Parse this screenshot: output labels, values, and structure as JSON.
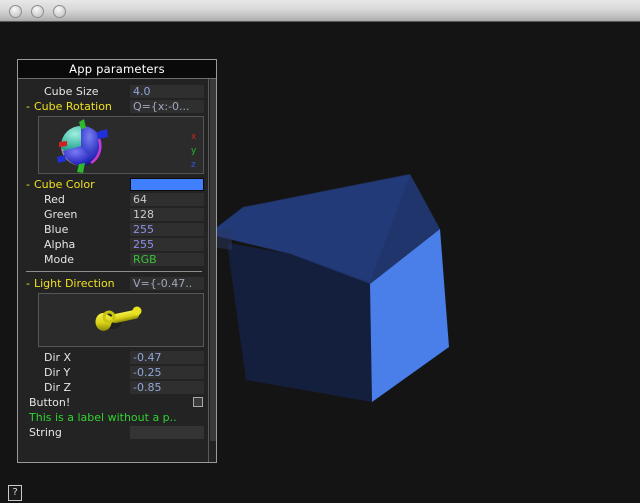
{
  "window": {
    "title": "",
    "buttons": [
      "close",
      "minimize",
      "zoom"
    ],
    "background_color": "#141414"
  },
  "help_button": {
    "glyph": "?"
  },
  "tweakbar": {
    "title": "App parameters",
    "rows": [
      {
        "type": "value",
        "label": "Cube Size",
        "value": "4.0",
        "value_color": "#8fa6d8"
      },
      {
        "type": "group",
        "label": "Cube Rotation",
        "value": "Q={x:-0...",
        "expander": "-",
        "value_color": "#9fa9bd"
      },
      {
        "type": "widget",
        "name": "rotation-ball",
        "axes": [
          "x",
          "y",
          "z"
        ],
        "axis_colors": [
          "#cc2222",
          "#22bb22",
          "#3355dd"
        ]
      },
      {
        "type": "color",
        "label": "Cube Color",
        "expander": "-",
        "swatch_color": "#4080ff"
      },
      {
        "type": "value",
        "label": "Red",
        "value": "64",
        "value_color": "#c9c9c9"
      },
      {
        "type": "value",
        "label": "Green",
        "value": "128",
        "value_color": "#c9c9c9"
      },
      {
        "type": "value",
        "label": "Blue",
        "value": "255",
        "value_color": "#8f8fe8"
      },
      {
        "type": "value",
        "label": "Alpha",
        "value": "255",
        "value_color": "#8f8fe8"
      },
      {
        "type": "value",
        "label": "Mode",
        "value": "RGB",
        "value_color": "#35c535"
      },
      {
        "type": "separator"
      },
      {
        "type": "group",
        "label": "Light Direction",
        "value": "V={-0.47..",
        "expander": "-",
        "value_color": "#9fa9bd"
      },
      {
        "type": "widget",
        "name": "light-arrow"
      },
      {
        "type": "value",
        "label": "Dir X",
        "value": "-0.47",
        "value_color": "#8fa6d8"
      },
      {
        "type": "value",
        "label": "Dir Y",
        "value": "-0.25",
        "value_color": "#8fa6d8"
      },
      {
        "type": "value",
        "label": "Dir Z",
        "value": "-0.85",
        "value_color": "#8fa6d8"
      },
      {
        "type": "button",
        "label": "Button!"
      },
      {
        "type": "note",
        "label": "This is a label without a p.."
      },
      {
        "type": "text",
        "label": "String",
        "value": ""
      }
    ]
  },
  "scene": {
    "object": "cube",
    "face_colors": {
      "front_right": "#4a7ee8",
      "top": "#20356b",
      "left": "#15203f"
    }
  }
}
